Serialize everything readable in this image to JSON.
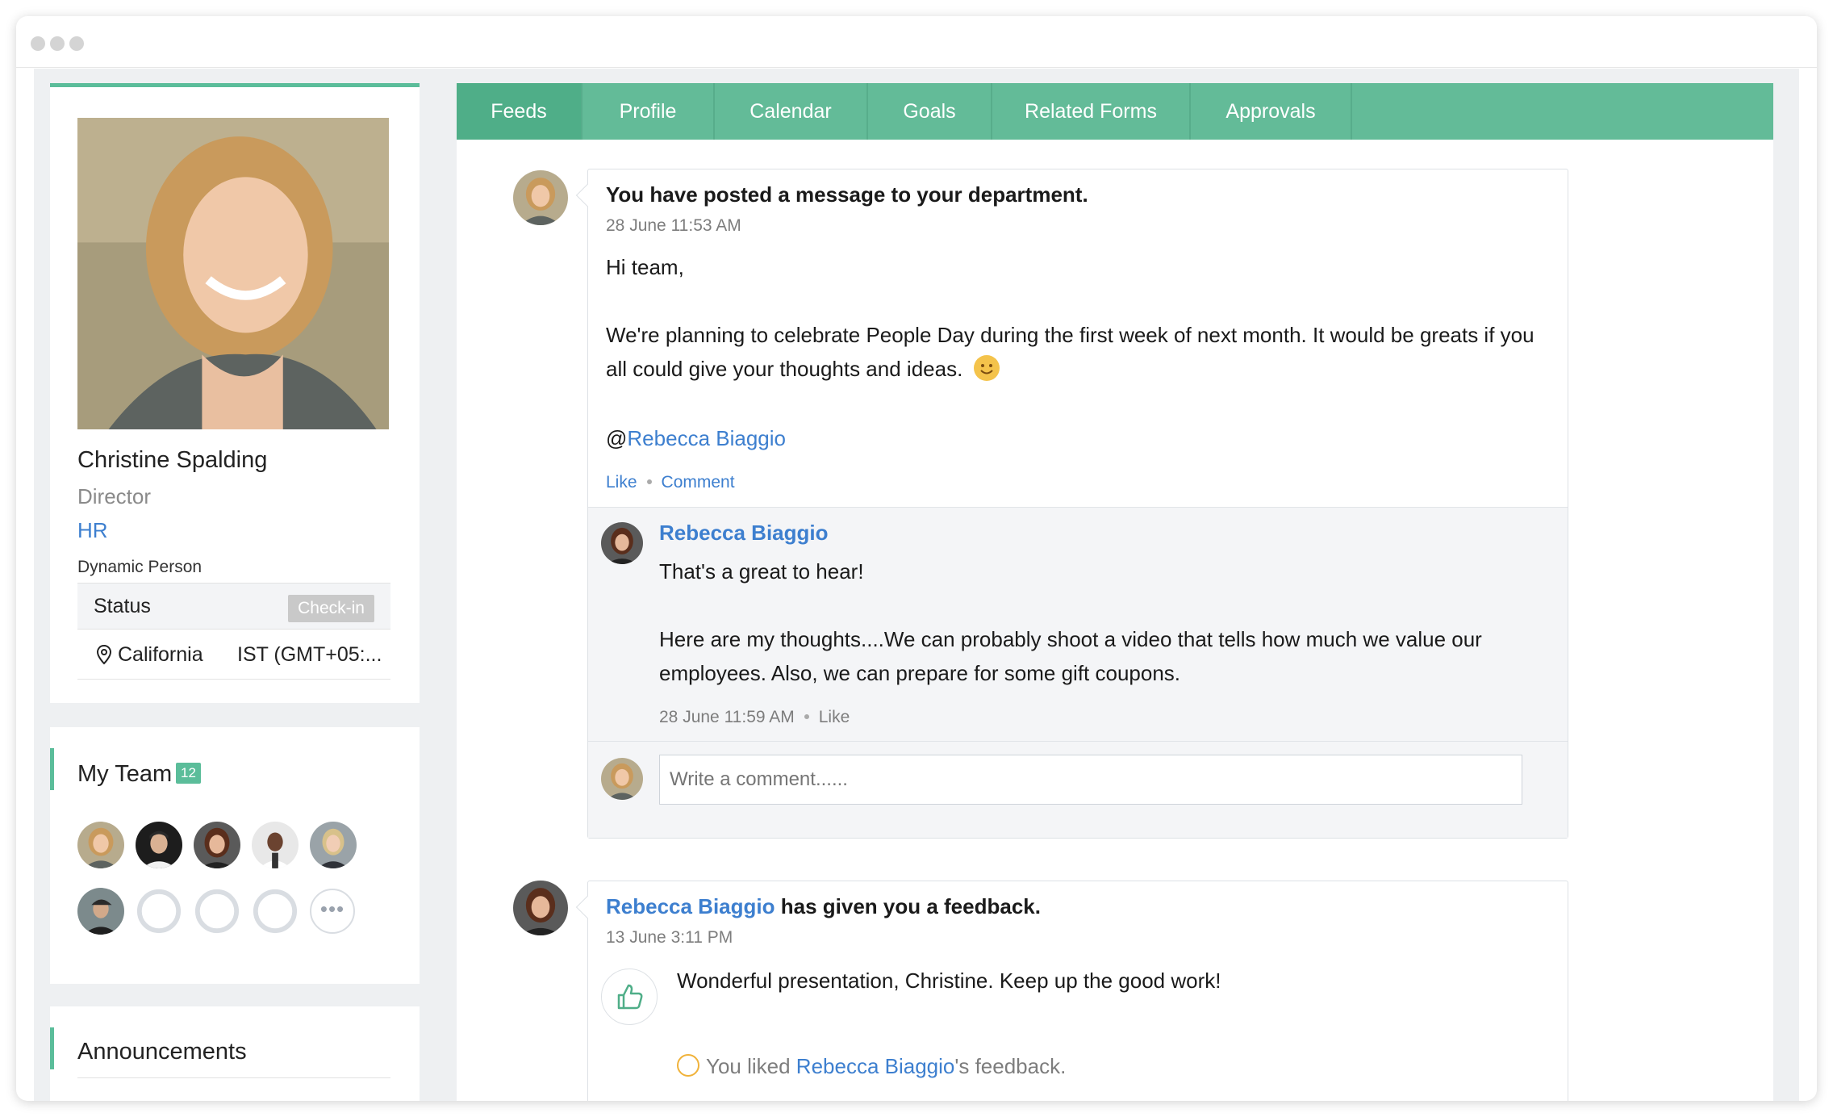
{
  "profile": {
    "name": "Christine Spalding",
    "title": "Director",
    "department": "HR",
    "tag": "Dynamic Person",
    "status_label": "Status",
    "checkin_label": "Check-in",
    "location": "California",
    "timezone": "IST (GMT+05:..."
  },
  "team": {
    "title": "My Team",
    "count": "12"
  },
  "announcements": {
    "title": "Announcements"
  },
  "tabs": [
    {
      "label": "Feeds",
      "active": true
    },
    {
      "label": "Profile"
    },
    {
      "label": "Calendar"
    },
    {
      "label": "Goals"
    },
    {
      "label": "Related Forms"
    },
    {
      "label": "Approvals"
    }
  ],
  "post1": {
    "heading": "You have posted a message to your department.",
    "time": "28 June 11:53 AM",
    "greeting": "Hi team,",
    "body_line1": "We're planning to celebrate People Day during the first week of next month. It would be greats if you",
    "body_line2": "all could give your thoughts and ideas.",
    "mention_at": "@",
    "mention_name": "Rebecca Biaggio",
    "like_label": "Like",
    "comment_label": "Comment"
  },
  "reply1": {
    "name": "Rebecca Biaggio",
    "line1": "That's a great to hear!",
    "line2": "Here are my thoughts....We can probably shoot a video that tells how much we value our",
    "line3": "employees. Also, we can prepare for some gift coupons.",
    "time": "28 June 11:59 AM",
    "like_label": "Like"
  },
  "comment_box": {
    "placeholder": "Write a comment......"
  },
  "post2": {
    "name": "Rebecca Biaggio",
    "heading_rest": " has given you a feedback.",
    "time": "13 June 3:11 PM",
    "feedback": "Wonderful presentation, Christine. Keep up the good work!",
    "liked_prefix": "You liked ",
    "liked_name": "Rebecca Biaggio",
    "liked_suffix": "'s feedback."
  },
  "colors": {
    "accent_green": "#63bb98",
    "link_blue": "#3d7fcf"
  },
  "icons": [
    "location-pin-icon",
    "smiley-icon",
    "thumbs-up-icon",
    "more-icon"
  ]
}
